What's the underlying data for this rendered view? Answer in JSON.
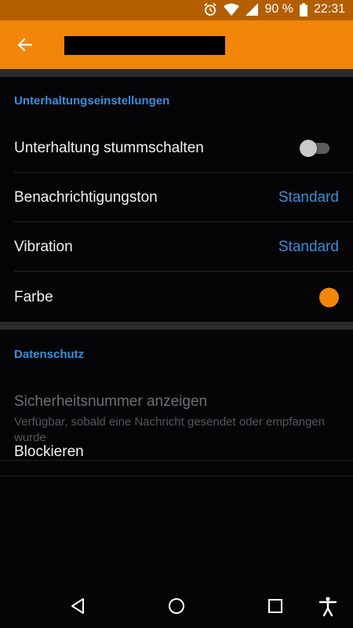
{
  "status_bar": {
    "battery": "90 %",
    "time": "22:31"
  },
  "app_bar": {
    "back_icon": "arrow-left-icon"
  },
  "sections": {
    "conversation": {
      "header": "Unterhaltungseinstellungen",
      "mute_label": "Unterhaltung stummschalten",
      "mute_enabled": false,
      "notification_label": "Benachrichtigungston",
      "notification_value": "Standard",
      "vibration_label": "Vibration",
      "vibration_value": "Standard",
      "color_label": "Farbe",
      "color_value": "#f28609"
    },
    "privacy": {
      "header": "Datenschutz",
      "safety_number_label": "Sicherheitsnummer anzeigen",
      "safety_number_sub": "Verfügbar, sobald eine Nachricht gesendet oder empfangen wurde",
      "block_label": "Blockieren"
    }
  },
  "colors": {
    "accent": "#f28609",
    "link": "#3a8ed8",
    "background": "#050508"
  }
}
